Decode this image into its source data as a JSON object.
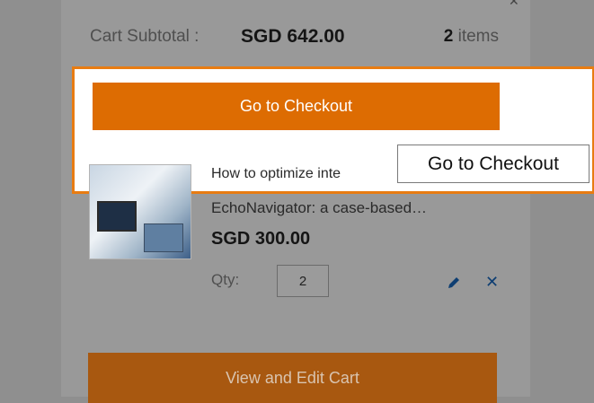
{
  "cart": {
    "subtotal_label": "Cart Subtotal :",
    "subtotal_value": "SGD 642.00",
    "items_count": "2",
    "items_label": "items",
    "checkout_label": "Go to Checkout",
    "tooltip_text": "Go to Checkout",
    "view_edit_label": "View and Edit Cart",
    "close_icon": "close-icon"
  },
  "item": {
    "name_line1": "How to optimize inte",
    "name_line2": "EchoNavigator: a case-based…",
    "price": "SGD 300.00",
    "qty_label": "Qty:",
    "qty_value": "2",
    "edit_icon": "pencil-icon",
    "remove_icon": "close-icon"
  },
  "colors": {
    "checkout_button": "#dd6c02",
    "highlight_border": "#e87c12",
    "remove_icon": "#0e3e72"
  }
}
